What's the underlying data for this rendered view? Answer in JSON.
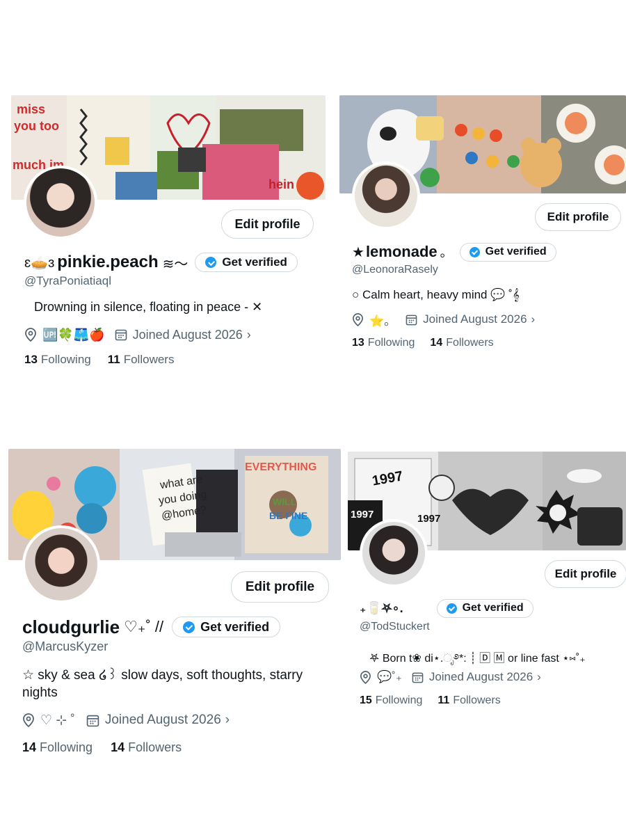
{
  "profiles": [
    {
      "name_prefix": "ɛ🥧ɜ",
      "name": "pinkie.peach",
      "name_suffix": "≋〜",
      "verified_label": "Get verified",
      "handle": "@TyraPoniatiaql",
      "bio": "Drowning in silence, floating in peace - ✕",
      "location": "🆙🍀🩳🍎",
      "joined": "Joined August 2026",
      "following_count": "13",
      "following_label": "Following",
      "followers_count": "11",
      "followers_label": "Followers",
      "edit_label": "Edit profile"
    },
    {
      "name_prefix": "★",
      "name": "lemonade",
      "name_suffix": "。",
      "verified_label": "Get verified",
      "handle": "@LeonoraRasely",
      "bio": "○ Calm heart, heavy mind 💬 ˚𝄞",
      "location": "⭐。",
      "joined": "Joined August 2026",
      "following_count": "13",
      "following_label": "Following",
      "followers_count": "14",
      "followers_label": "Followers",
      "edit_label": "Edit profile"
    },
    {
      "name_prefix": "",
      "name": "cloudgurlie",
      "name_suffix": "♡₊˚ //",
      "verified_label": "Get verified",
      "handle": "@MarcusKyzer",
      "bio": "☆ sky & sea ໒꒱ slow days, soft thoughts, starry nights",
      "location": "♡ ⊹ ˚",
      "joined": "Joined August 2026",
      "following_count": "14",
      "following_label": "Following",
      "followers_count": "14",
      "followers_label": "Followers",
      "edit_label": "Edit profile"
    },
    {
      "name_prefix": "₊🥛⛧∘.",
      "name": "",
      "name_suffix": "",
      "verified_label": "Get verified",
      "handle": "@TodStuckert",
      "bio": "𖤐 Born t❀ di⋆.ೃ࿔*: ┊ 🄳 🄼 or line fast ⋆⑅˚₊",
      "location": "💬˚₊",
      "joined": "Joined August 2026",
      "following_count": "15",
      "following_label": "Following",
      "followers_count": "11",
      "followers_label": "Followers",
      "edit_label": "Edit profile"
    }
  ],
  "banner_texts": {
    "p0": [
      "miss",
      "you too",
      "much im",
      "hein"
    ],
    "p2": [
      "what are",
      "you doing",
      "@home?",
      "EVERYTHING",
      "WILL",
      "BE FINE"
    ],
    "p3": [
      "1997",
      "1997",
      "1997"
    ]
  },
  "colors": {
    "verified_blue": "#1d9bf0",
    "text_primary": "#0f1419",
    "text_secondary": "#536471",
    "border": "#cfd9de"
  }
}
